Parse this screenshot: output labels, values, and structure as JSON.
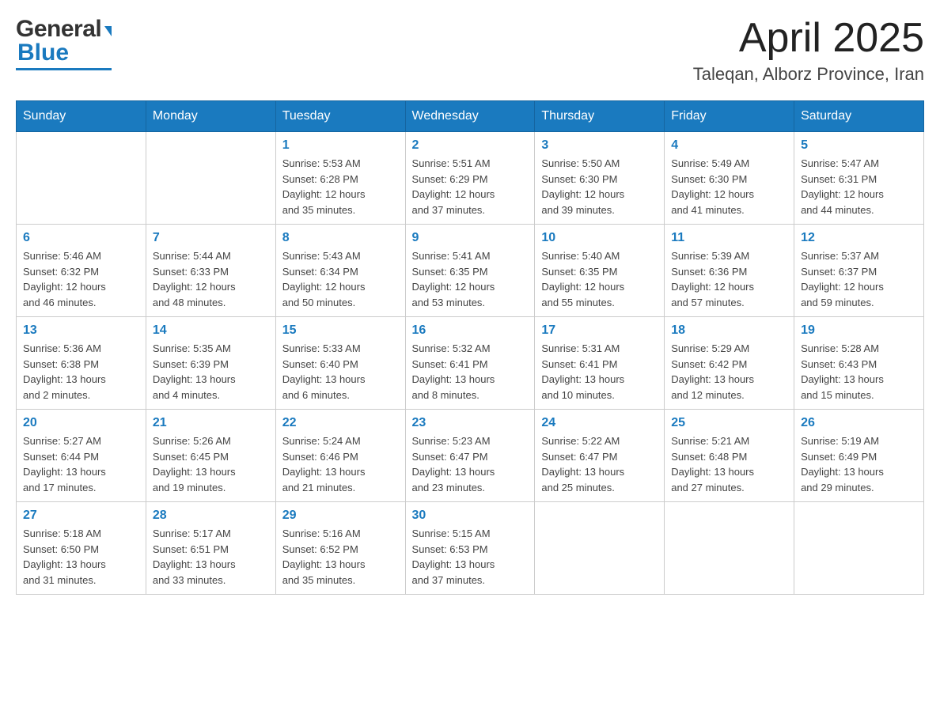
{
  "header": {
    "month_title": "April 2025",
    "location": "Taleqan, Alborz Province, Iran",
    "logo_general": "General",
    "logo_blue": "Blue"
  },
  "days_of_week": [
    "Sunday",
    "Monday",
    "Tuesday",
    "Wednesday",
    "Thursday",
    "Friday",
    "Saturday"
  ],
  "weeks": [
    [
      {
        "day": "",
        "info": ""
      },
      {
        "day": "",
        "info": ""
      },
      {
        "day": "1",
        "info": "Sunrise: 5:53 AM\nSunset: 6:28 PM\nDaylight: 12 hours\nand 35 minutes."
      },
      {
        "day": "2",
        "info": "Sunrise: 5:51 AM\nSunset: 6:29 PM\nDaylight: 12 hours\nand 37 minutes."
      },
      {
        "day": "3",
        "info": "Sunrise: 5:50 AM\nSunset: 6:30 PM\nDaylight: 12 hours\nand 39 minutes."
      },
      {
        "day": "4",
        "info": "Sunrise: 5:49 AM\nSunset: 6:30 PM\nDaylight: 12 hours\nand 41 minutes."
      },
      {
        "day": "5",
        "info": "Sunrise: 5:47 AM\nSunset: 6:31 PM\nDaylight: 12 hours\nand 44 minutes."
      }
    ],
    [
      {
        "day": "6",
        "info": "Sunrise: 5:46 AM\nSunset: 6:32 PM\nDaylight: 12 hours\nand 46 minutes."
      },
      {
        "day": "7",
        "info": "Sunrise: 5:44 AM\nSunset: 6:33 PM\nDaylight: 12 hours\nand 48 minutes."
      },
      {
        "day": "8",
        "info": "Sunrise: 5:43 AM\nSunset: 6:34 PM\nDaylight: 12 hours\nand 50 minutes."
      },
      {
        "day": "9",
        "info": "Sunrise: 5:41 AM\nSunset: 6:35 PM\nDaylight: 12 hours\nand 53 minutes."
      },
      {
        "day": "10",
        "info": "Sunrise: 5:40 AM\nSunset: 6:35 PM\nDaylight: 12 hours\nand 55 minutes."
      },
      {
        "day": "11",
        "info": "Sunrise: 5:39 AM\nSunset: 6:36 PM\nDaylight: 12 hours\nand 57 minutes."
      },
      {
        "day": "12",
        "info": "Sunrise: 5:37 AM\nSunset: 6:37 PM\nDaylight: 12 hours\nand 59 minutes."
      }
    ],
    [
      {
        "day": "13",
        "info": "Sunrise: 5:36 AM\nSunset: 6:38 PM\nDaylight: 13 hours\nand 2 minutes."
      },
      {
        "day": "14",
        "info": "Sunrise: 5:35 AM\nSunset: 6:39 PM\nDaylight: 13 hours\nand 4 minutes."
      },
      {
        "day": "15",
        "info": "Sunrise: 5:33 AM\nSunset: 6:40 PM\nDaylight: 13 hours\nand 6 minutes."
      },
      {
        "day": "16",
        "info": "Sunrise: 5:32 AM\nSunset: 6:41 PM\nDaylight: 13 hours\nand 8 minutes."
      },
      {
        "day": "17",
        "info": "Sunrise: 5:31 AM\nSunset: 6:41 PM\nDaylight: 13 hours\nand 10 minutes."
      },
      {
        "day": "18",
        "info": "Sunrise: 5:29 AM\nSunset: 6:42 PM\nDaylight: 13 hours\nand 12 minutes."
      },
      {
        "day": "19",
        "info": "Sunrise: 5:28 AM\nSunset: 6:43 PM\nDaylight: 13 hours\nand 15 minutes."
      }
    ],
    [
      {
        "day": "20",
        "info": "Sunrise: 5:27 AM\nSunset: 6:44 PM\nDaylight: 13 hours\nand 17 minutes."
      },
      {
        "day": "21",
        "info": "Sunrise: 5:26 AM\nSunset: 6:45 PM\nDaylight: 13 hours\nand 19 minutes."
      },
      {
        "day": "22",
        "info": "Sunrise: 5:24 AM\nSunset: 6:46 PM\nDaylight: 13 hours\nand 21 minutes."
      },
      {
        "day": "23",
        "info": "Sunrise: 5:23 AM\nSunset: 6:47 PM\nDaylight: 13 hours\nand 23 minutes."
      },
      {
        "day": "24",
        "info": "Sunrise: 5:22 AM\nSunset: 6:47 PM\nDaylight: 13 hours\nand 25 minutes."
      },
      {
        "day": "25",
        "info": "Sunrise: 5:21 AM\nSunset: 6:48 PM\nDaylight: 13 hours\nand 27 minutes."
      },
      {
        "day": "26",
        "info": "Sunrise: 5:19 AM\nSunset: 6:49 PM\nDaylight: 13 hours\nand 29 minutes."
      }
    ],
    [
      {
        "day": "27",
        "info": "Sunrise: 5:18 AM\nSunset: 6:50 PM\nDaylight: 13 hours\nand 31 minutes."
      },
      {
        "day": "28",
        "info": "Sunrise: 5:17 AM\nSunset: 6:51 PM\nDaylight: 13 hours\nand 33 minutes."
      },
      {
        "day": "29",
        "info": "Sunrise: 5:16 AM\nSunset: 6:52 PM\nDaylight: 13 hours\nand 35 minutes."
      },
      {
        "day": "30",
        "info": "Sunrise: 5:15 AM\nSunset: 6:53 PM\nDaylight: 13 hours\nand 37 minutes."
      },
      {
        "day": "",
        "info": ""
      },
      {
        "day": "",
        "info": ""
      },
      {
        "day": "",
        "info": ""
      }
    ]
  ]
}
